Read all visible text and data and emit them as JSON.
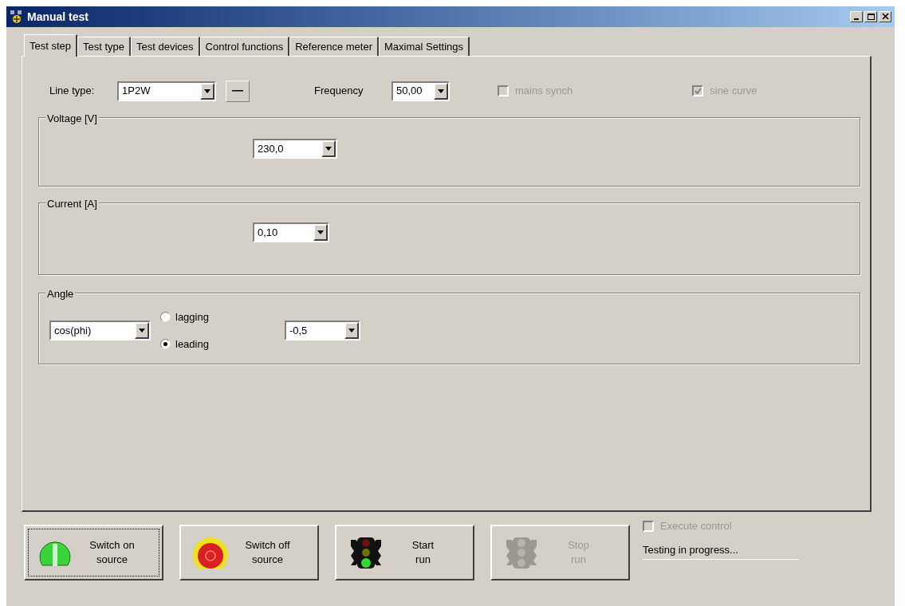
{
  "window": {
    "title": "Manual test"
  },
  "tabs": [
    {
      "label": "Test step",
      "selected": true
    },
    {
      "label": "Test type",
      "selected": false
    },
    {
      "label": "Test devices",
      "selected": false
    },
    {
      "label": "Control functions",
      "selected": false
    },
    {
      "label": "Reference meter",
      "selected": false
    },
    {
      "label": "Maximal Settings",
      "selected": false
    }
  ],
  "line_type": {
    "label": "Line type:",
    "value": "1P2W"
  },
  "frequency": {
    "label": "Frequency",
    "value": "50,00"
  },
  "options": [
    {
      "label": "mains synch",
      "checked": false,
      "disabled": true
    },
    {
      "label": "sine curve",
      "checked": true,
      "disabled": true
    }
  ],
  "groups": [
    {
      "title": "Voltage [V]",
      "value": "230,0"
    },
    {
      "title": "Current [A]",
      "value": "0,10"
    }
  ],
  "angle": {
    "title": "Angle",
    "mode": "cos(phi)",
    "radios": [
      {
        "label": "lagging",
        "selected": false
      },
      {
        "label": "leading",
        "selected": true
      }
    ],
    "value": "-0,5"
  },
  "actions": [
    {
      "kind": "power-on",
      "lines": [
        "Switch on",
        "source"
      ],
      "focused": true,
      "disabled": false
    },
    {
      "kind": "power-off",
      "lines": [
        "Switch off",
        "source"
      ],
      "focused": false,
      "disabled": false
    },
    {
      "kind": "start",
      "lines": [
        "Start",
        "run"
      ],
      "focused": false,
      "disabled": false
    },
    {
      "kind": "stop",
      "lines": [
        "Stop",
        "run"
      ],
      "focused": false,
      "disabled": true
    }
  ],
  "execute_control": {
    "label": "Execute control",
    "checked": false,
    "disabled": true
  },
  "status": "Testing in progress..."
}
